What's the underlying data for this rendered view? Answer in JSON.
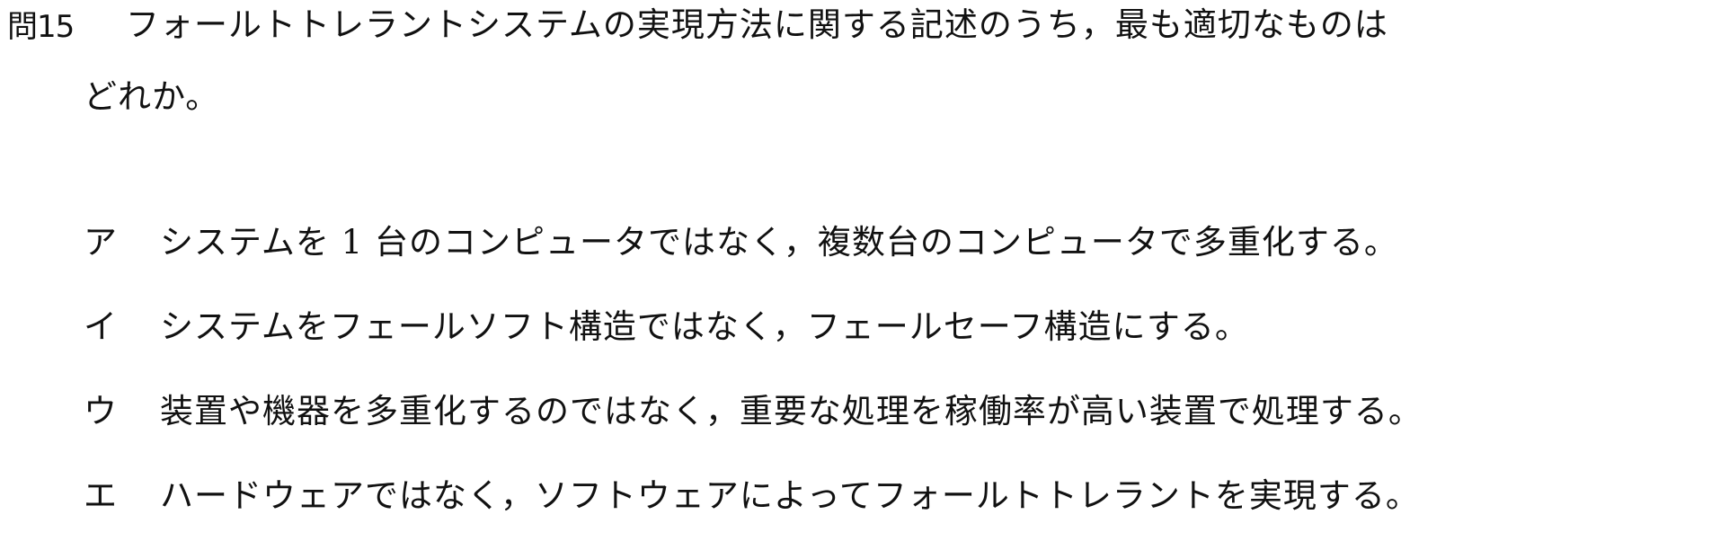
{
  "question": {
    "number": "問15",
    "line1": "フォールトトレラントシステムの実現方法に関する記述のうち，最も適切なものは",
    "line2": "どれか。"
  },
  "choices": [
    {
      "label": "ア",
      "text": "システムを 1 台のコンピュータではなく，複数台のコンピュータで多重化する。"
    },
    {
      "label": "イ",
      "text": "システムをフェールソフト構造ではなく，フェールセーフ構造にする。"
    },
    {
      "label": "ウ",
      "text": "装置や機器を多重化するのではなく，重要な処理を稼働率が高い装置で処理する。"
    },
    {
      "label": "エ",
      "text": "ハードウェアではなく，ソフトウェアによってフォールトトレラントを実現する。"
    }
  ]
}
